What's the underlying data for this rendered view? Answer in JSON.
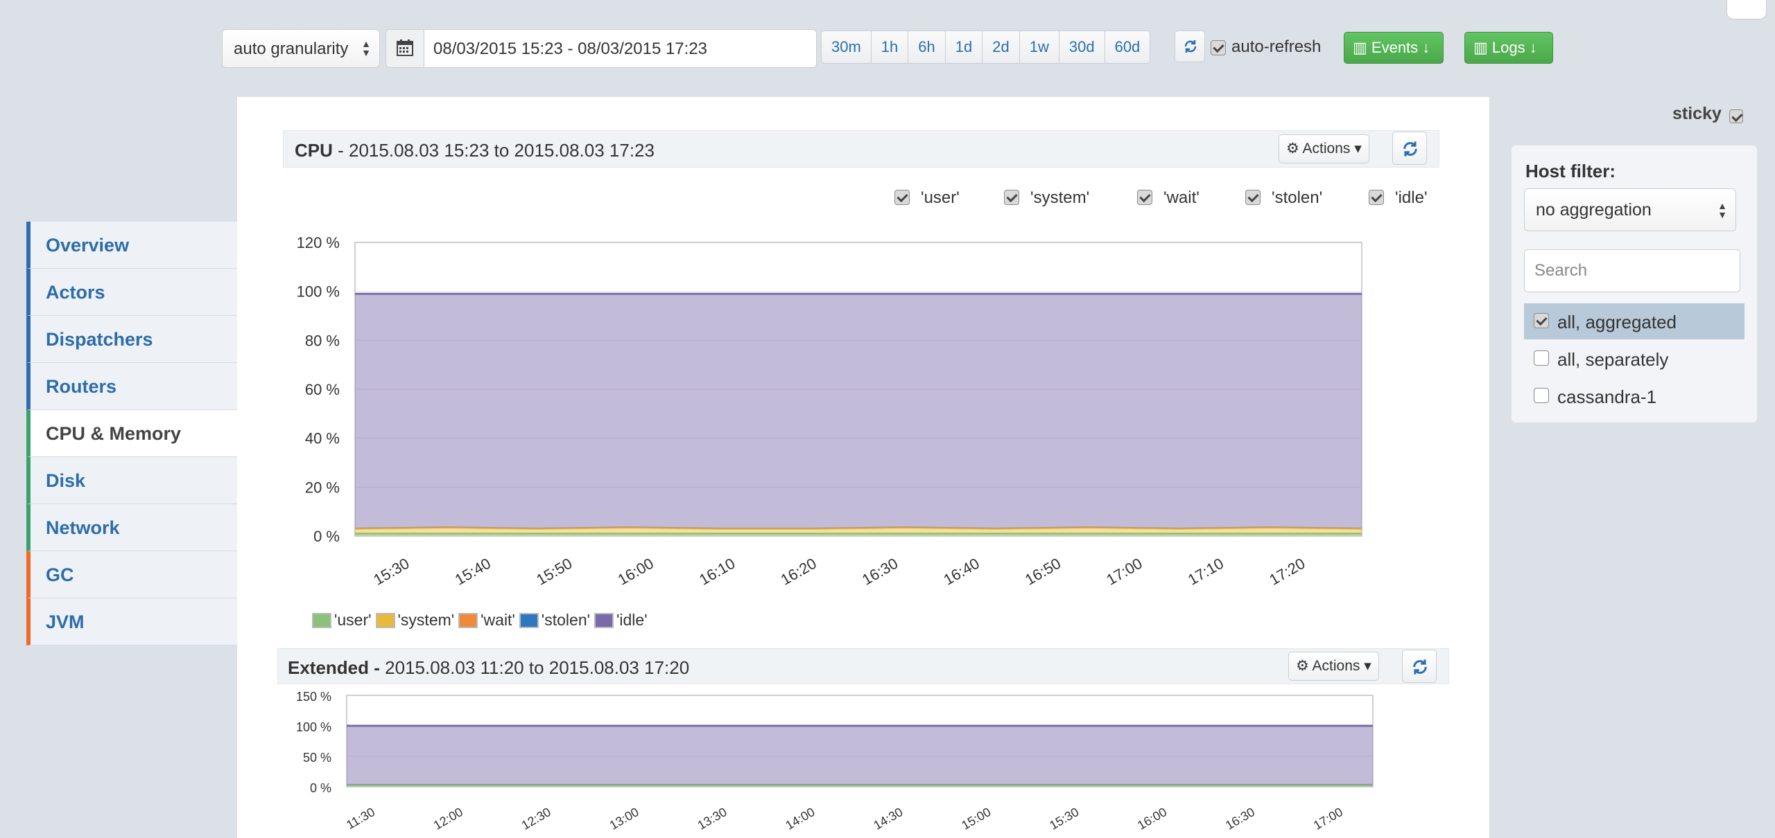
{
  "toolbar": {
    "granularity": "auto granularity",
    "date_range": "08/03/2015 15:23 - 08/03/2015 17:23",
    "ranges": [
      "30m",
      "1h",
      "6h",
      "1d",
      "2d",
      "1w",
      "30d",
      "60d"
    ],
    "auto_refresh_label": "auto-refresh",
    "events_label": "Events",
    "logs_label": "Logs"
  },
  "sidebar": {
    "items": [
      {
        "label": "Overview",
        "color": "#2f6db0"
      },
      {
        "label": "Actors",
        "color": "#2f6db0"
      },
      {
        "label": "Dispatchers",
        "color": "#2f6db0"
      },
      {
        "label": "Routers",
        "color": "#2f6db0"
      },
      {
        "label": "CPU & Memory",
        "color": "#3aa36b"
      },
      {
        "label": "Disk",
        "color": "#3aa36b"
      },
      {
        "label": "Network",
        "color": "#3aa36b"
      },
      {
        "label": "GC",
        "color": "#ef6a2a"
      },
      {
        "label": "JVM",
        "color": "#ef6a2a"
      }
    ],
    "active_index": 4
  },
  "cpu_panel": {
    "title_bold": "CPU",
    "title_rest": " - 2015.08.03 15:23 to 2015.08.03 17:23",
    "actions_label": "Actions",
    "series_toggles": [
      "'user'",
      "'system'",
      "'wait'",
      "'stolen'",
      "'idle'"
    ]
  },
  "extended_panel": {
    "title_bold": "Extended -",
    "title_rest": " 2015.08.03 11:20 to 2015.08.03 17:20",
    "actions_label": "Actions"
  },
  "host_filter": {
    "label": "Host filter:",
    "aggregation": "no aggregation",
    "search_placeholder": "Search",
    "hosts": [
      {
        "label": "all, aggregated",
        "checked": true
      },
      {
        "label": "all, separately",
        "checked": false
      },
      {
        "label": "cassandra-1",
        "checked": false
      }
    ]
  },
  "sticky_label": "sticky",
  "chart_data": [
    {
      "type": "area",
      "title": "CPU - 2015.08.03 15:23 to 2015.08.03 17:23",
      "y_tick_labels": [
        "0 %",
        "20 %",
        "40 %",
        "60 %",
        "80 %",
        "100 %",
        "120 %"
      ],
      "ylim": [
        0,
        120
      ],
      "x_tick_labels": [
        "15:30",
        "15:40",
        "15:50",
        "16:00",
        "16:10",
        "16:20",
        "16:30",
        "16:40",
        "16:50",
        "17:00",
        "17:10",
        "17:20"
      ],
      "legend": "bottom",
      "stacked": true,
      "series": [
        {
          "name": "'user'",
          "color": "#8cc17a",
          "values": [
            1,
            1,
            1,
            1,
            1,
            1,
            1,
            1,
            1,
            1,
            1,
            1
          ]
        },
        {
          "name": "'system'",
          "color": "#e8b93a",
          "values": [
            2,
            2.5,
            2,
            2.5,
            2,
            2,
            2.5,
            2,
            2.5,
            2,
            2.5,
            2
          ]
        },
        {
          "name": "'wait'",
          "color": "#ef8a3a",
          "values": [
            0,
            0,
            0,
            0,
            0,
            0,
            0,
            0,
            0,
            0,
            0,
            0
          ]
        },
        {
          "name": "'stolen'",
          "color": "#2f78c0",
          "values": [
            0,
            0,
            0,
            0,
            0,
            0,
            0,
            0,
            0,
            0,
            0,
            0
          ]
        },
        {
          "name": "'idle'",
          "color": "#7b6aaa",
          "values": [
            96,
            95.5,
            96,
            95.5,
            96,
            96,
            95.5,
            96,
            95.5,
            96,
            95.5,
            96
          ]
        }
      ]
    },
    {
      "type": "area",
      "title": "Extended - 2015.08.03 11:20 to 2015.08.03 17:20",
      "y_tick_labels": [
        "0 %",
        "50 %",
        "100 %",
        "150 %"
      ],
      "ylim": [
        0,
        150
      ],
      "x_tick_labels": [
        "11:30",
        "12:00",
        "12:30",
        "13:00",
        "13:30",
        "14:00",
        "14:30",
        "15:00",
        "15:30",
        "16:00",
        "16:30",
        "17:00"
      ],
      "stacked": true,
      "series": [
        {
          "name": "'user'",
          "color": "#8cc17a",
          "values": [
            3,
            3,
            3,
            3,
            3,
            3,
            3,
            3,
            3,
            3,
            3,
            3
          ]
        },
        {
          "name": "'idle'",
          "color": "#7b6aaa",
          "values": [
            97,
            97,
            97,
            97,
            97,
            97,
            97,
            97,
            97,
            97,
            97,
            97
          ]
        }
      ]
    }
  ]
}
